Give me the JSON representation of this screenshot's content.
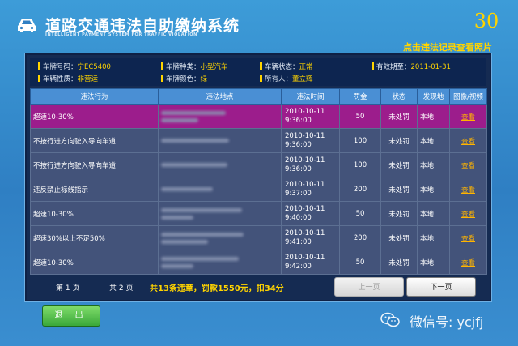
{
  "header": {
    "title": "道路交通违法自助缴纳系统",
    "subtitle": "INTELLIGENT PAYMENT SYSTEM FOR TRAFFIC VIOLATION",
    "countdown": "30",
    "hint": "点击违法记录查看照片"
  },
  "vehicle": {
    "plate_label": "车牌号码：",
    "plate_value": "宁EC5400",
    "type_label": "车牌种类：",
    "type_value": "小型汽车",
    "status_label": "车辆状态：",
    "status_value": "正常",
    "expiry_label": "有效期至：",
    "expiry_value": "2011-01-31",
    "nature_label": "车辆性质：",
    "nature_value": "非营运",
    "color_label": "车牌颜色：",
    "color_value": "绿",
    "owner_label": "所有人：",
    "owner_value": "董立辉"
  },
  "table": {
    "headers": [
      "违法行为",
      "违法地点",
      "违法时间",
      "罚金",
      "状态",
      "发现地",
      "图像/视频"
    ],
    "rows": [
      {
        "behavior": "超速10-30%",
        "date": "2010-10-11",
        "time": "9:36:00",
        "fine": "50",
        "status": "未处罚",
        "origin": "本地",
        "action": "查看"
      },
      {
        "behavior": "不按行进方向驶入导向车道",
        "date": "2010-10-11",
        "time": "9:36:00",
        "fine": "100",
        "status": "未处罚",
        "origin": "本地",
        "action": "查看"
      },
      {
        "behavior": "不按行进方向驶入导向车道",
        "date": "2010-10-11",
        "time": "9:36:00",
        "fine": "100",
        "status": "未处罚",
        "origin": "本地",
        "action": "查看"
      },
      {
        "behavior": "违反禁止标线指示",
        "date": "2010-10-11",
        "time": "9:37:00",
        "fine": "200",
        "status": "未处罚",
        "origin": "本地",
        "action": "查看"
      },
      {
        "behavior": "超速10-30%",
        "date": "2010-10-11",
        "time": "9:40:00",
        "fine": "50",
        "status": "未处罚",
        "origin": "本地",
        "action": "查看"
      },
      {
        "behavior": "超速30%以上不足50%",
        "date": "2010-10-11",
        "time": "9:41:00",
        "fine": "200",
        "status": "未处罚",
        "origin": "本地",
        "action": "查看"
      },
      {
        "behavior": "超速10-30%",
        "date": "2010-10-11",
        "time": "9:42:00",
        "fine": "50",
        "status": "未处罚",
        "origin": "本地",
        "action": "查看"
      }
    ]
  },
  "pager": {
    "current": "第 1 页",
    "total": "共 2 页",
    "summary": "共13条违章，罚款1550元，扣34分",
    "prev_label": "上一页",
    "next_label": "下一页"
  },
  "footer": {
    "exit_label": "退 出",
    "wechat": "微信号: ycjfj"
  },
  "colors": {
    "background": "#2f7fc3",
    "panel": "#152b52",
    "accent_yellow": "#ffd400",
    "selected_row": "#9c1d8c",
    "link": "#ffb400",
    "exit_green": "#3aa83a"
  },
  "icons": [
    "car-icon",
    "wechat-icon"
  ]
}
